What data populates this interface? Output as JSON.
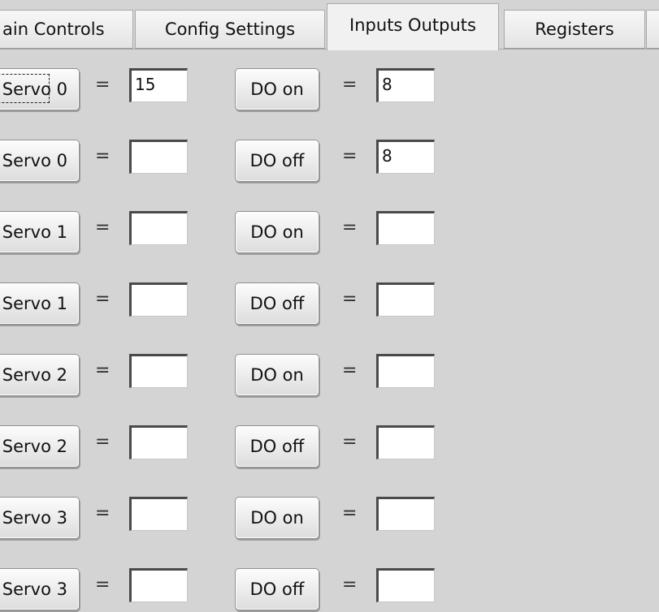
{
  "tabs": [
    {
      "label": "ain Controls",
      "active": false
    },
    {
      "label": "Config Settings",
      "active": false
    },
    {
      "label": "Inputs Outputs",
      "active": true
    },
    {
      "label": "Registers",
      "active": false
    },
    {
      "label": "",
      "active": false
    }
  ],
  "equals": "=",
  "rows": [
    {
      "servo_label": "Servo 0",
      "servo_value": "15",
      "do_label": "DO on",
      "do_value": "8"
    },
    {
      "servo_label": "Servo 0",
      "servo_value": "",
      "do_label": "DO off",
      "do_value": "8"
    },
    {
      "servo_label": "Servo 1",
      "servo_value": "",
      "do_label": "DO on",
      "do_value": ""
    },
    {
      "servo_label": "Servo 1",
      "servo_value": "",
      "do_label": "DO off",
      "do_value": ""
    },
    {
      "servo_label": "Servo 2",
      "servo_value": "",
      "do_label": "DO on",
      "do_value": ""
    },
    {
      "servo_label": "Servo 2",
      "servo_value": "",
      "do_label": "DO off",
      "do_value": ""
    },
    {
      "servo_label": "Servo 3",
      "servo_value": "",
      "do_label": "DO on",
      "do_value": ""
    },
    {
      "servo_label": "Servo 3",
      "servo_value": "",
      "do_label": "DO off",
      "do_value": ""
    }
  ]
}
